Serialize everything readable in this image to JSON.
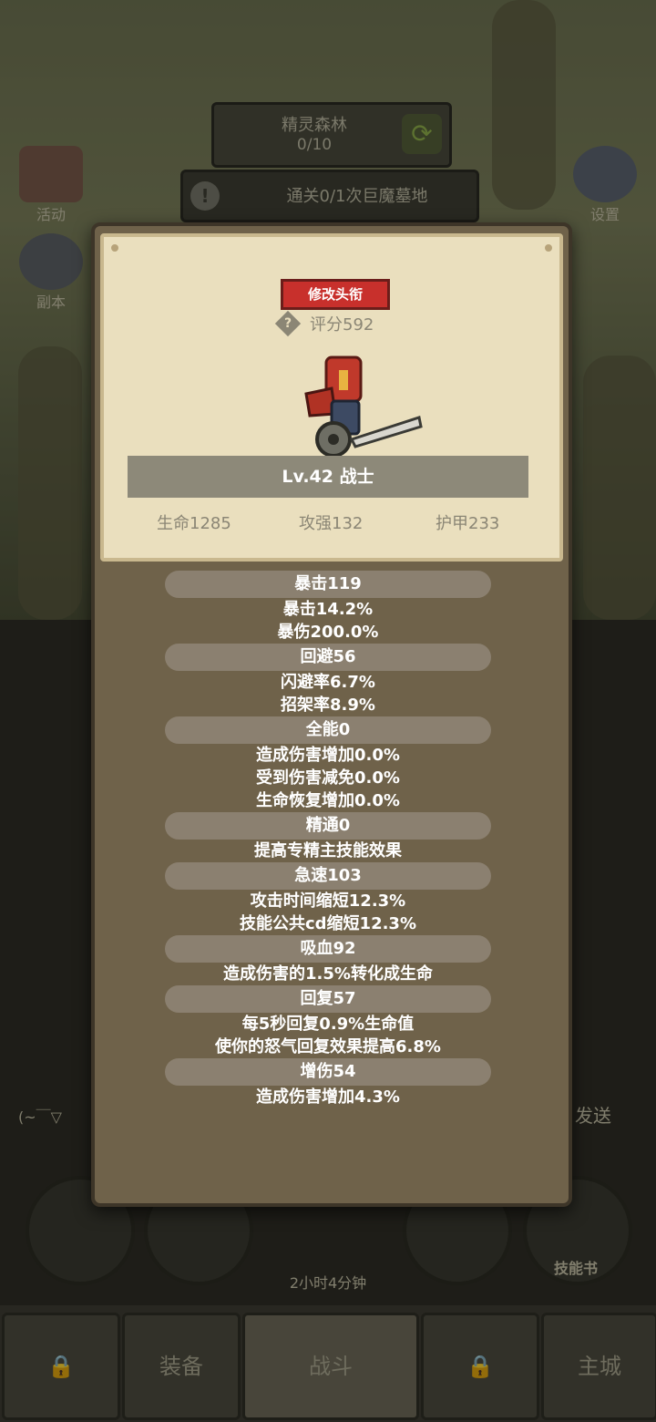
{
  "stage": {
    "name": "精灵森林",
    "progress": "0/10"
  },
  "quest": {
    "text": "通关0/1次巨魔墓地"
  },
  "side_menu": {
    "events": "活动",
    "dungeon": "副本",
    "settings": "设置"
  },
  "chest": {
    "timer": "2小时4分钟"
  },
  "skill_book": "技能书",
  "send_label": "发送",
  "chat_snippet": "(~￣▽",
  "nav": {
    "equipment": "装备",
    "battle": "战斗",
    "main_city": "主城"
  },
  "profile": {
    "change_title_button": "修改头衔",
    "score": "评分592",
    "level_class": "Lv.42 战士",
    "hp": "生命1285",
    "attack": "攻强132",
    "armor": "护甲233"
  },
  "stats": [
    {
      "header": "暴击119",
      "lines": [
        "暴击14.2%",
        "暴伤200.0%"
      ]
    },
    {
      "header": "回避56",
      "lines": [
        "闪避率6.7%",
        "招架率8.9%"
      ]
    },
    {
      "header": "全能0",
      "lines": [
        "造成伤害增加0.0%",
        "受到伤害减免0.0%",
        "生命恢复增加0.0%"
      ]
    },
    {
      "header": "精通0",
      "lines": [
        "提高专精主技能效果"
      ]
    },
    {
      "header": "急速103",
      "lines": [
        "攻击时间缩短12.3%",
        "技能公共cd缩短12.3%"
      ]
    },
    {
      "header": "吸血92",
      "lines": [
        "造成伤害的1.5%转化成生命"
      ]
    },
    {
      "header": "回复57",
      "lines": [
        "每5秒回复0.9%生命值",
        "使你的怒气回复效果提高6.8%"
      ]
    },
    {
      "header": "增伤54",
      "lines": [
        "造成伤害增加4.3%"
      ]
    }
  ],
  "colors": {
    "title_button": "#c8302c",
    "parchment": "#eadfbe",
    "panel": "#6f624a"
  }
}
